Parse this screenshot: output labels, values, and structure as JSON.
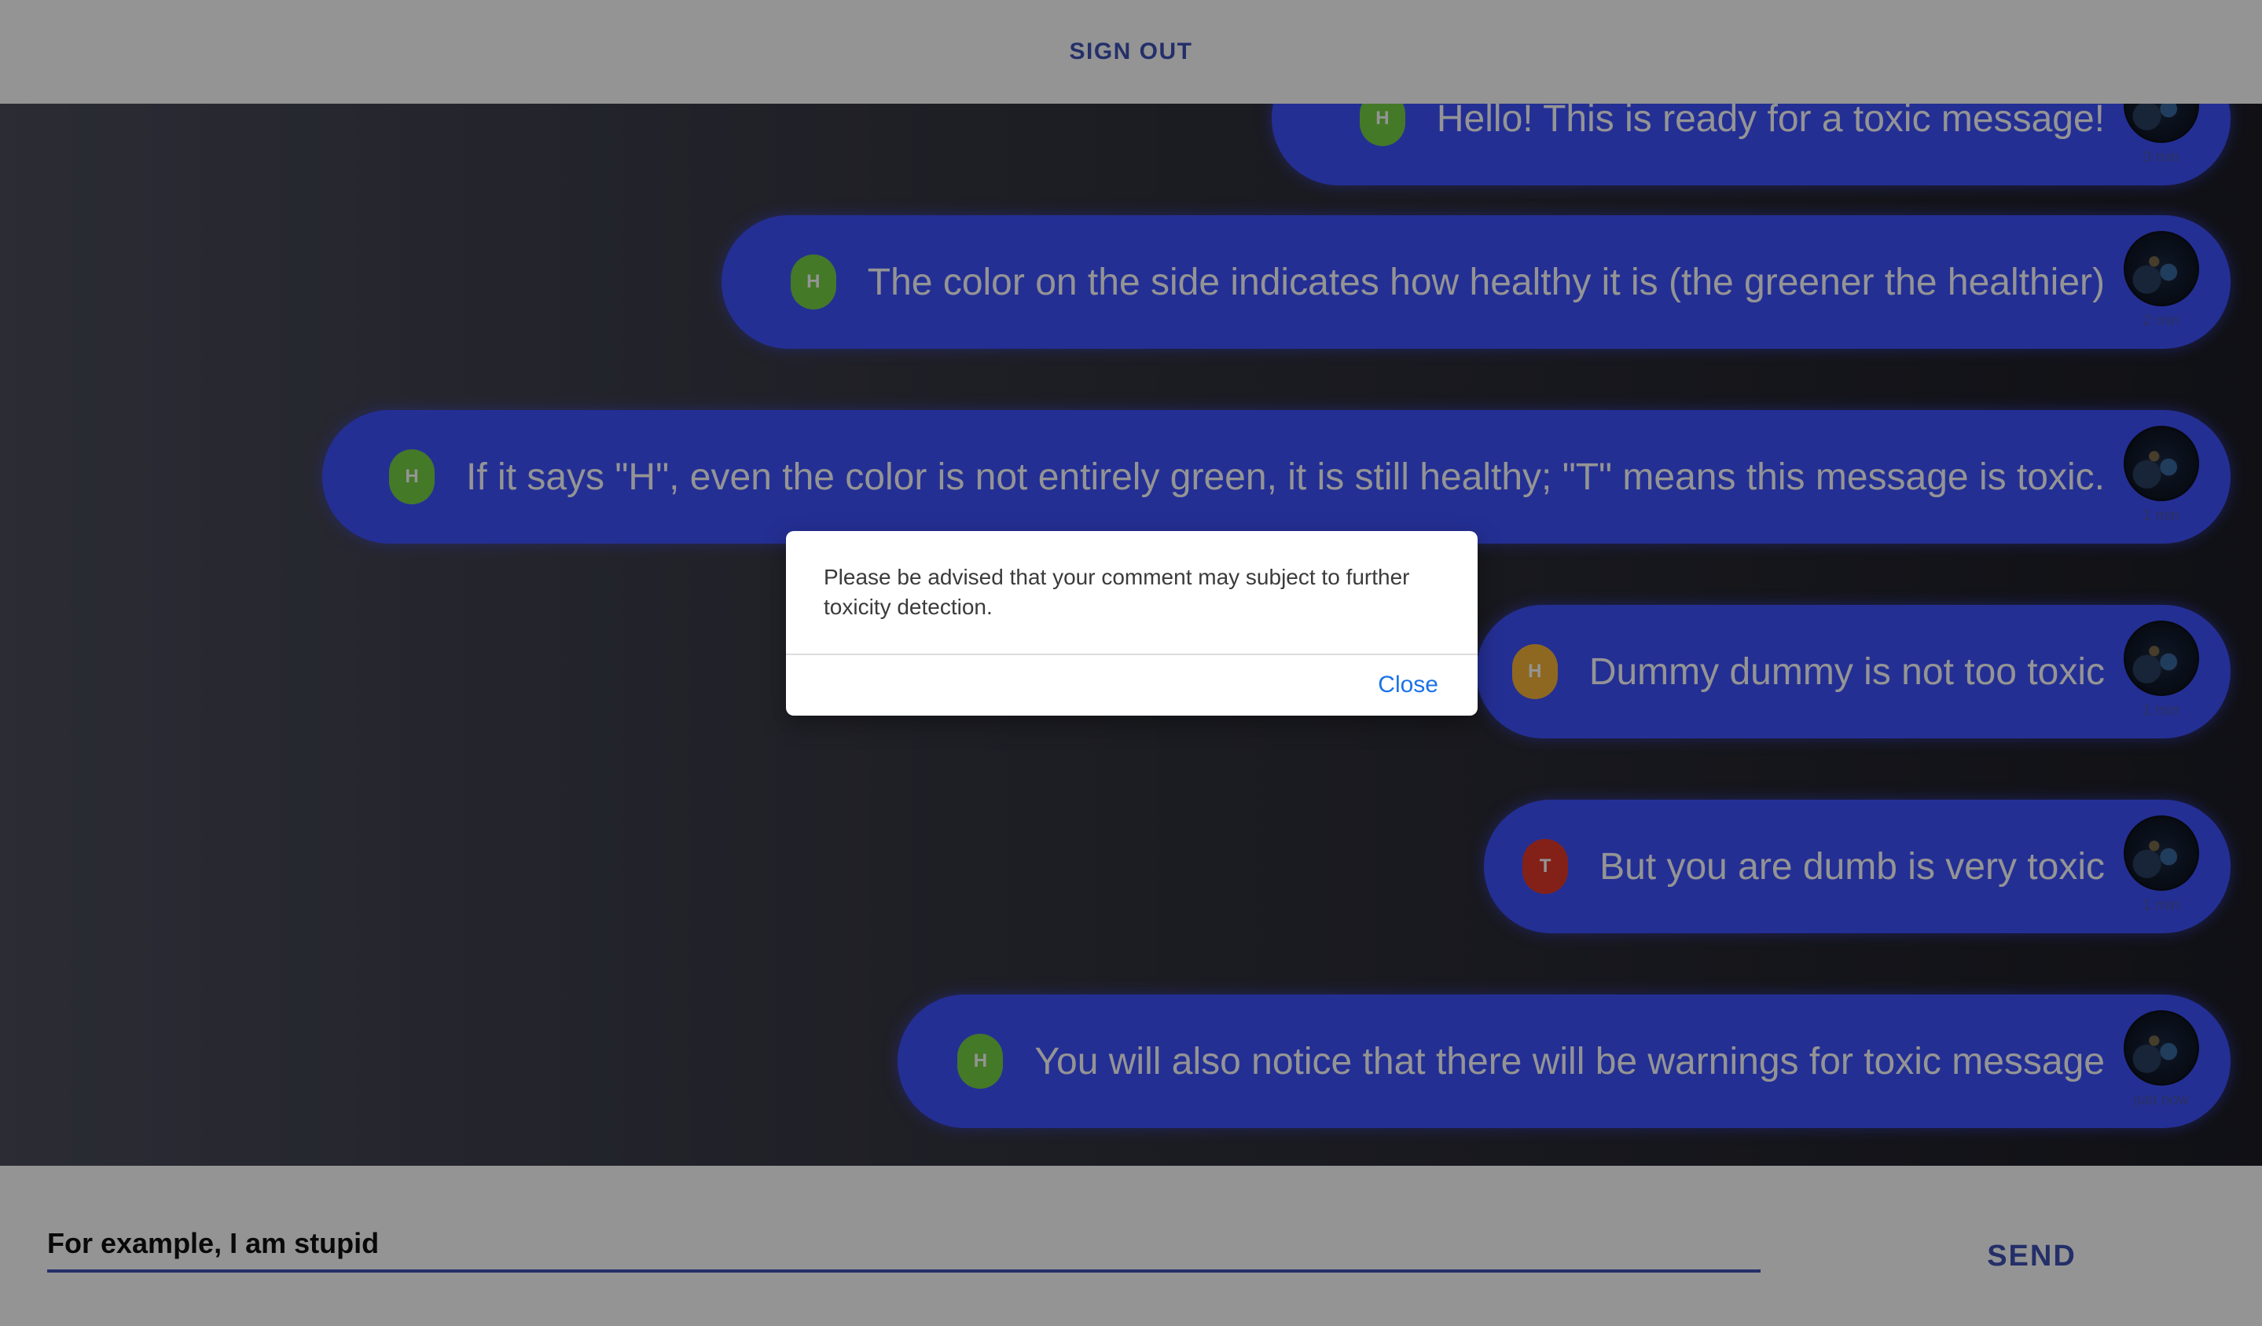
{
  "header": {
    "signout_label": "SIGN OUT"
  },
  "messages": [
    {
      "badge": "H",
      "badge_color": "#76d145",
      "text": "Hello! This is ready for a toxic message!",
      "time": "3 min",
      "avatar": "user-avatar"
    },
    {
      "badge": "H",
      "badge_color": "#76d145",
      "text": "The color on the side indicates how healthy it is (the greener the healthier)",
      "time": "2 min",
      "avatar": "user-avatar"
    },
    {
      "badge": "H",
      "badge_color": "#76d145",
      "text": "If it says \"H\", even the color is not entirely green, it is still healthy; \"T\" means this message is toxic.",
      "time": "1 min",
      "avatar": "user-avatar"
    },
    {
      "badge": "H",
      "badge_color": "#f4b43a",
      "text": "Dummy dummy is not too toxic",
      "time": "1 min",
      "avatar": "user-avatar"
    },
    {
      "badge": "T",
      "badge_color": "#e23a2a",
      "text": "But you are dumb is very toxic",
      "time": "1 min",
      "avatar": "user-avatar"
    },
    {
      "badge": "H",
      "badge_color": "#76d145",
      "text": "You will also notice that there will be warnings for toxic message",
      "time": "just now",
      "avatar": "user-avatar"
    }
  ],
  "composer": {
    "value": "For example, I am stupid",
    "send_label": "SEND"
  },
  "dialog": {
    "message": "Please be advised that your comment may subject to further toxicity detection.",
    "close_label": "Close"
  },
  "colors": {
    "accent": "#3f51b5",
    "bubble": "#3f51ff",
    "link": "#1a73e8"
  }
}
